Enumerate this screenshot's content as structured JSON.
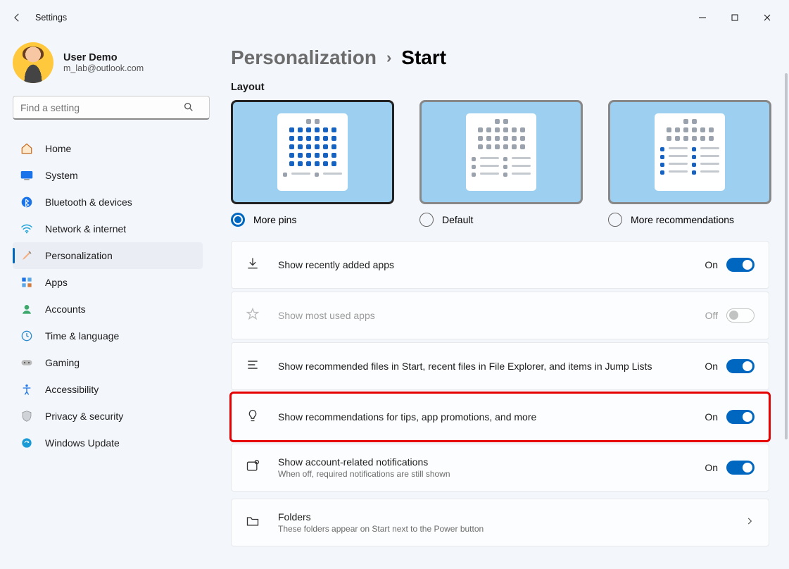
{
  "app_title": "Settings",
  "user": {
    "name": "User Demo",
    "email": "m_lab@outlook.com"
  },
  "search": {
    "placeholder": "Find a setting"
  },
  "nav": [
    {
      "label": "Home"
    },
    {
      "label": "System"
    },
    {
      "label": "Bluetooth & devices"
    },
    {
      "label": "Network & internet"
    },
    {
      "label": "Personalization"
    },
    {
      "label": "Apps"
    },
    {
      "label": "Accounts"
    },
    {
      "label": "Time & language"
    },
    {
      "label": "Gaming"
    },
    {
      "label": "Accessibility"
    },
    {
      "label": "Privacy & security"
    },
    {
      "label": "Windows Update"
    }
  ],
  "breadcrumb": {
    "parent": "Personalization",
    "current": "Start"
  },
  "section_layout": "Layout",
  "layouts": [
    {
      "label": "More pins",
      "selected": true
    },
    {
      "label": "Default",
      "selected": false
    },
    {
      "label": "More recommendations",
      "selected": false
    }
  ],
  "settings": [
    {
      "title": "Show recently added apps",
      "state": "On",
      "on": true,
      "disabled": false
    },
    {
      "title": "Show most used apps",
      "state": "Off",
      "on": false,
      "disabled": true
    },
    {
      "title": "Show recommended files in Start, recent files in File Explorer, and items in Jump Lists",
      "state": "On",
      "on": true,
      "disabled": false
    },
    {
      "title": "Show recommendations for tips, app promotions, and more",
      "state": "On",
      "on": true,
      "disabled": false,
      "highlight": true
    },
    {
      "title": "Show account-related notifications",
      "sub": "When off, required notifications are still shown",
      "state": "On",
      "on": true,
      "disabled": false
    },
    {
      "title": "Folders",
      "sub": "These folders appear on Start next to the Power button",
      "nav": true
    }
  ]
}
